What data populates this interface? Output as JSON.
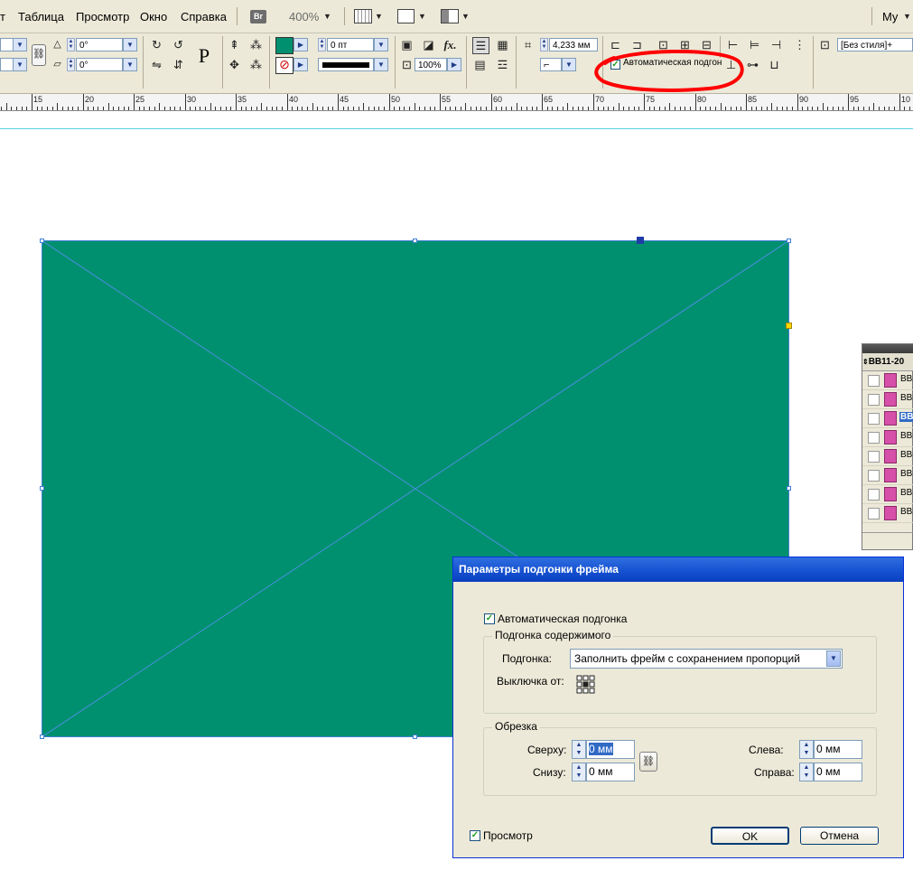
{
  "menubar": {
    "items": [
      "т",
      "Таблица",
      "Просмотр",
      "Окно",
      "Справка"
    ],
    "bridge_badge": "Br",
    "zoom": "400%",
    "workspace": "My"
  },
  "control": {
    "angle1": "0°",
    "angle2": "0°",
    "stroke_weight": "0 пт",
    "size_value": "4,233 мм",
    "opacity": "100%",
    "auto_fit_label": "Автоматическая подгон",
    "style_value": "[Без стиля]+",
    "paragraph_glyph": "P",
    "fx_glyph": "fx."
  },
  "ruler": {
    "labels": [
      "15",
      "20",
      "25",
      "30",
      "35",
      "40",
      "45",
      "50",
      "55",
      "60",
      "65",
      "70",
      "75",
      "80",
      "85",
      "90",
      "95",
      "10"
    ]
  },
  "links_panel": {
    "title": "BB11-20",
    "items": [
      "BB",
      "BB",
      "BB",
      "BB",
      "BB",
      "BB",
      "BB",
      "BB"
    ],
    "selected_index": 2
  },
  "dialog": {
    "title": "Параметры подгонки фрейма",
    "auto_fit_label": "Автоматическая подгонка",
    "content_fitting_group": "Подгонка содержимого",
    "fitting_label": "Подгонка:",
    "fitting_value": "Заполнить фрейм с сохранением пропорций",
    "align_from_label": "Выключка от:",
    "crop_group": "Обрезка",
    "top_label": "Сверху:",
    "top_value": "0 мм",
    "bottom_label": "Снизу:",
    "bottom_value": "0 мм",
    "left_label": "Слева:",
    "left_value": "0 мм",
    "right_label": "Справа:",
    "right_value": "0 мм",
    "preview_label": "Просмотр",
    "ok_label": "OK",
    "cancel_label": "Отмена"
  },
  "colors": {
    "fill_swatch": "#00906f",
    "highlight_circle": "#ff0000",
    "dialog_title_bar": "#1450d0"
  }
}
